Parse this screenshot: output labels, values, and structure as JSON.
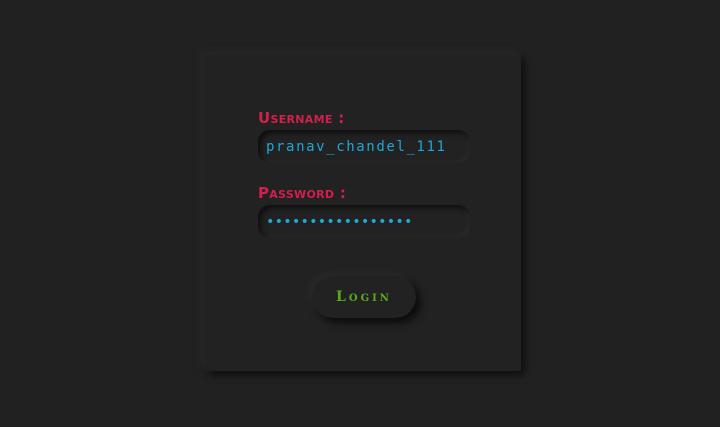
{
  "form": {
    "username_label": "Username :",
    "username_value": "pranav_chandel_111",
    "password_label": "Password :",
    "password_value": "*****************",
    "login_label": "Login"
  },
  "colors": {
    "background": "#212121",
    "label": "#d21f4b",
    "input_text": "#1ea7d7",
    "button_text": "#5ea91f"
  }
}
